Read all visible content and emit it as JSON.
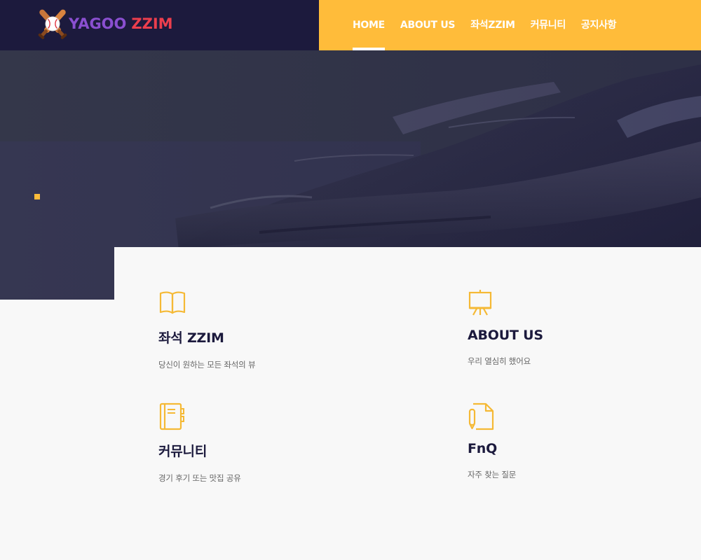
{
  "brand": {
    "logo_word1": "YAGOO",
    "logo_word2": "ZZIM",
    "logo_icon": "crossed-bats-baseball-icon",
    "colors": {
      "navy": "#1c1a3d",
      "yellow": "#ffbc3a",
      "purple": "#8a4fd0",
      "red": "#ec3e4d"
    }
  },
  "nav": {
    "items": [
      {
        "label": "HOME",
        "active": true
      },
      {
        "label": "ABOUT US",
        "active": false
      },
      {
        "label": "좌석ZZIM",
        "active": false
      },
      {
        "label": "커뮤니티",
        "active": false
      },
      {
        "label": "공지사항",
        "active": false
      }
    ]
  },
  "hero": {
    "background": "baseball-glove-photo"
  },
  "features": [
    {
      "icon": "open-book-icon",
      "title": "좌석 ZZIM",
      "desc": "당신이 원하는 모든 좌석의 뷰"
    },
    {
      "icon": "easel-presentation-icon",
      "title": "ABOUT US",
      "desc": "우리 열심히 했어요"
    },
    {
      "icon": "notebook-icon",
      "title": "커뮤니티",
      "desc": "경기 후기 또는 맛집 공유"
    },
    {
      "icon": "document-pen-icon",
      "title": "FnQ",
      "desc": "자주 찾는 질문"
    }
  ]
}
